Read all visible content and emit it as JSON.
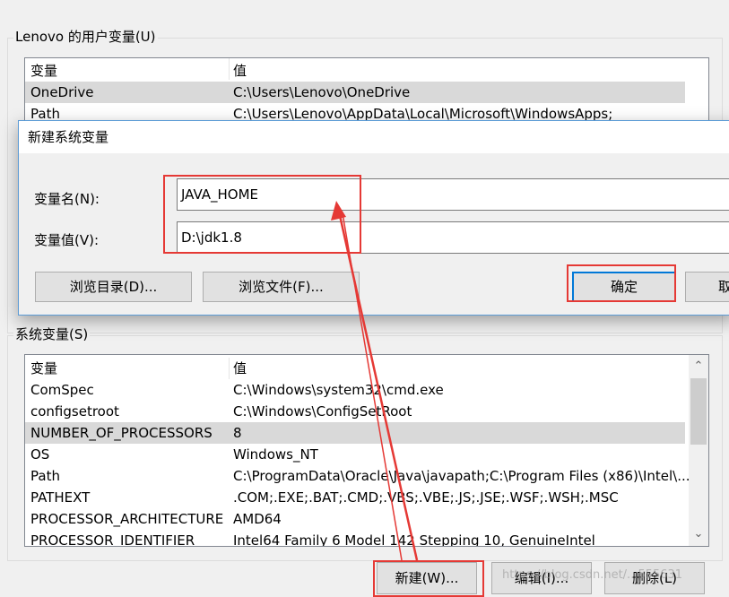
{
  "user_vars": {
    "group_title": "Lenovo 的用户变量(U)",
    "col_var": "变量",
    "col_val": "值",
    "rows": [
      {
        "var": "OneDrive",
        "val": "C:\\Users\\Lenovo\\OneDrive"
      },
      {
        "var": "Path",
        "val": "C:\\Users\\Lenovo\\AppData\\Local\\Microsoft\\WindowsApps;"
      }
    ]
  },
  "dialog": {
    "title": "新建系统变量",
    "name_label": "变量名(N):",
    "name_value": "JAVA_HOME",
    "value_label": "变量值(V):",
    "value_value": "D:\\jdk1.8",
    "browse_dir_label": "浏览目录(D)...",
    "browse_file_label": "浏览文件(F)...",
    "ok_label": "确定",
    "cancel_label": "取"
  },
  "sys_vars": {
    "group_title": "系统变量(S)",
    "col_var": "变量",
    "col_val": "值",
    "rows": [
      {
        "var": "ComSpec",
        "val": "C:\\Windows\\system32\\cmd.exe"
      },
      {
        "var": "configsetroot",
        "val": "C:\\Windows\\ConfigSetRoot"
      },
      {
        "var": "NUMBER_OF_PROCESSORS",
        "val": "8"
      },
      {
        "var": "OS",
        "val": "Windows_NT"
      },
      {
        "var": "Path",
        "val": "C:\\ProgramData\\Oracle\\Java\\javapath;C:\\Program Files (x86)\\Intel\\..."
      },
      {
        "var": "PATHEXT",
        "val": ".COM;.EXE;.BAT;.CMD;.VBS;.VBE;.JS;.JSE;.WSF;.WSH;.MSC"
      },
      {
        "var": "PROCESSOR_ARCHITECTURE",
        "val": "AMD64"
      },
      {
        "var": "PROCESSOR_IDENTIFIER",
        "val": "Intel64 Family 6 Model 142 Stepping 10, GenuineIntel"
      }
    ],
    "new_label": "新建(W)...",
    "edit_label": "编辑(I)...",
    "delete_label": "删除(L)"
  },
  "watermark": "https://blog.csdn.net/...555631",
  "annotation_color": "#e53935"
}
